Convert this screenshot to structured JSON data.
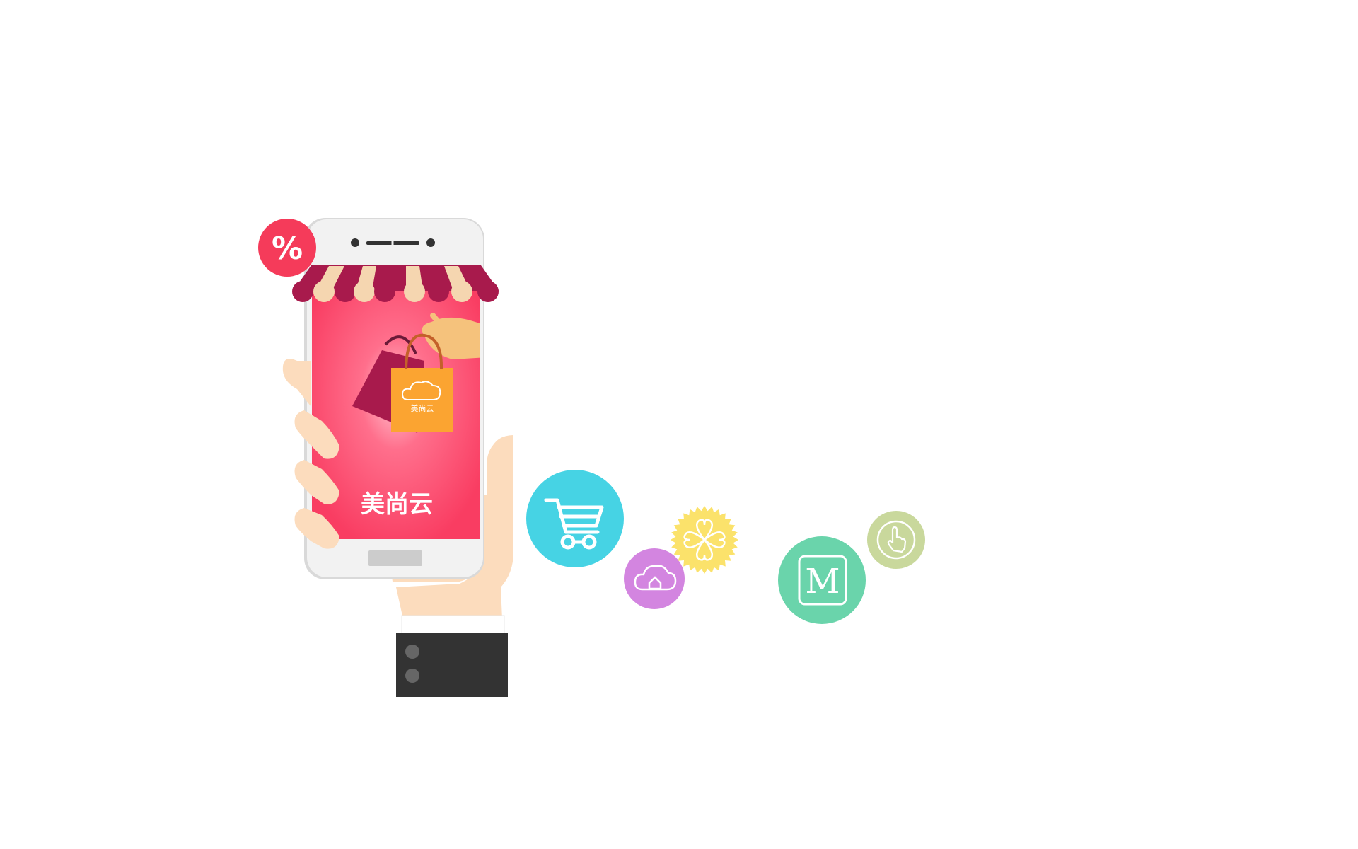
{
  "illustration": {
    "discount_badge": {
      "text": "%",
      "color": "#f53b5a"
    },
    "phone": {
      "screen_color": "#fa3d61",
      "brand_name": "美尚云",
      "bag_label": "美尚云"
    },
    "floating_icons": [
      {
        "name": "shopping-cart",
        "color": "#46d3e4"
      },
      {
        "name": "cloud-home",
        "color": "#d385e0"
      },
      {
        "name": "clover",
        "color": "#fbe26b"
      },
      {
        "name": "letter-m",
        "color": "#6ad4ab",
        "text": "M"
      },
      {
        "name": "hand-pointer",
        "color": "#c9d89c"
      }
    ]
  }
}
